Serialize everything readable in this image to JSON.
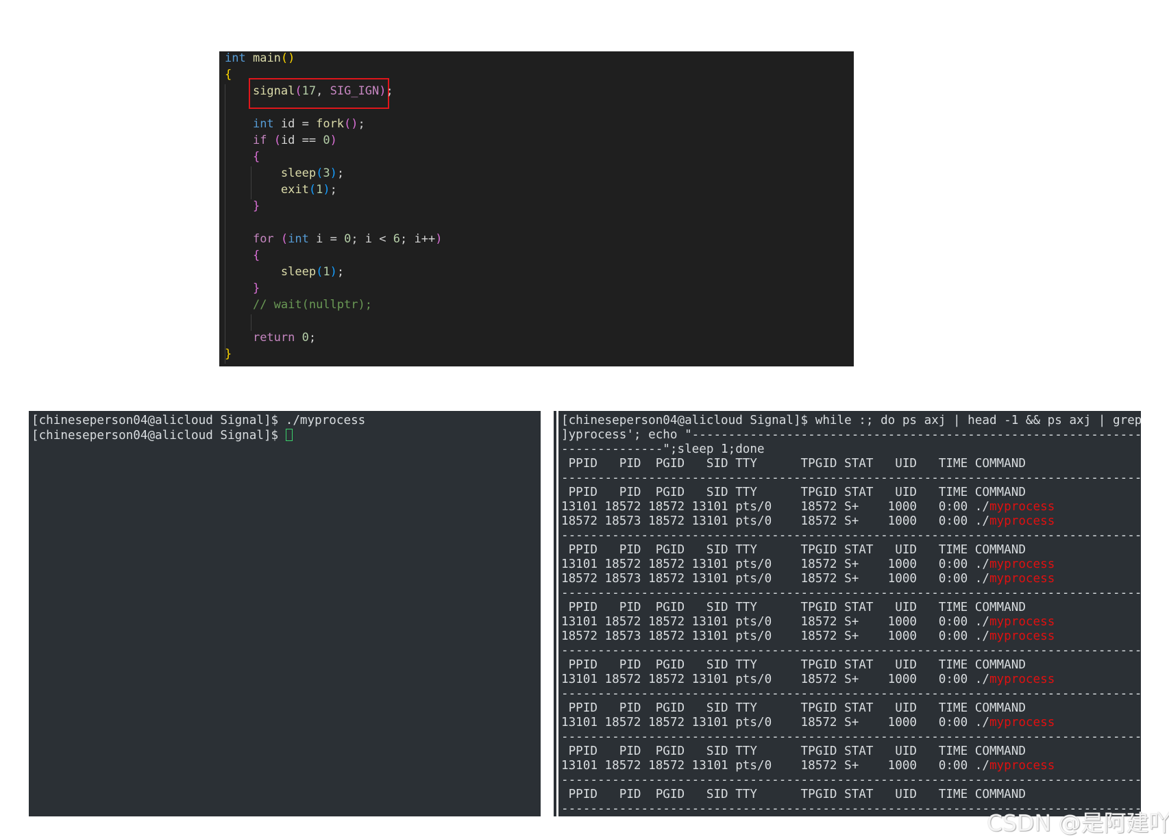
{
  "editor": {
    "lines": [
      [
        [
          "kw",
          "int"
        ],
        [
          "id",
          " "
        ],
        [
          "fn",
          "main"
        ],
        [
          "br1",
          "()"
        ]
      ],
      [
        [
          "br1",
          "{"
        ]
      ],
      [
        [
          "id",
          "    "
        ],
        [
          "fn",
          "signal"
        ],
        [
          "br2",
          "("
        ],
        [
          "num",
          "17"
        ],
        [
          "id",
          ", "
        ],
        [
          "mac",
          "SIG_IGN"
        ],
        [
          "br2",
          ")"
        ],
        [
          "id",
          ";"
        ]
      ],
      [],
      [
        [
          "id",
          "    "
        ],
        [
          "kw",
          "int"
        ],
        [
          "id",
          " id = "
        ],
        [
          "fn",
          "fork"
        ],
        [
          "br2",
          "()"
        ],
        [
          "id",
          ";"
        ]
      ],
      [
        [
          "id",
          "    "
        ],
        [
          "ctl",
          "if"
        ],
        [
          "id",
          " "
        ],
        [
          "br2",
          "("
        ],
        [
          "id",
          "id == "
        ],
        [
          "num",
          "0"
        ],
        [
          "br2",
          ")"
        ]
      ],
      [
        [
          "id",
          "    "
        ],
        [
          "br2",
          "{"
        ]
      ],
      [
        [
          "id",
          "        "
        ],
        [
          "fn",
          "sleep"
        ],
        [
          "br3",
          "("
        ],
        [
          "num",
          "3"
        ],
        [
          "br3",
          ")"
        ],
        [
          "id",
          ";"
        ]
      ],
      [
        [
          "id",
          "        "
        ],
        [
          "fn",
          "exit"
        ],
        [
          "br3",
          "("
        ],
        [
          "num",
          "1"
        ],
        [
          "br3",
          ")"
        ],
        [
          "id",
          ";"
        ]
      ],
      [
        [
          "id",
          "    "
        ],
        [
          "br2",
          "}"
        ]
      ],
      [],
      [
        [
          "id",
          "    "
        ],
        [
          "ctl",
          "for"
        ],
        [
          "id",
          " "
        ],
        [
          "br2",
          "("
        ],
        [
          "kw",
          "int"
        ],
        [
          "id",
          " i = "
        ],
        [
          "num",
          "0"
        ],
        [
          "id",
          "; i < "
        ],
        [
          "num",
          "6"
        ],
        [
          "id",
          "; i++"
        ],
        [
          "br2",
          ")"
        ]
      ],
      [
        [
          "id",
          "    "
        ],
        [
          "br2",
          "{"
        ]
      ],
      [
        [
          "id",
          "        "
        ],
        [
          "fn",
          "sleep"
        ],
        [
          "br3",
          "("
        ],
        [
          "num",
          "1"
        ],
        [
          "br3",
          ")"
        ],
        [
          "id",
          ";"
        ]
      ],
      [
        [
          "id",
          "    "
        ],
        [
          "br2",
          "}"
        ]
      ],
      [
        [
          "id",
          "    "
        ],
        [
          "cmt",
          "// wait(nullptr);"
        ]
      ],
      [],
      [
        [
          "id",
          "    "
        ],
        [
          "ctl",
          "return"
        ],
        [
          "id",
          " "
        ],
        [
          "num",
          "0"
        ],
        [
          "id",
          ";"
        ]
      ],
      [
        [
          "br1",
          "}"
        ]
      ]
    ]
  },
  "terminal_left": {
    "lines": [
      "[chineseperson04@alicloud Signal]$ ./myprocess",
      "[chineseperson04@alicloud Signal]$ "
    ]
  },
  "terminal_right": {
    "lines": [
      {
        "text": "[chineseperson04@alicloud Signal]$ while :; do ps axj | head -1 && ps axj | grep '[m"
      },
      {
        "text": "]yprocess'; echo \"-----------------------------------------------------------------------------"
      },
      {
        "text": "--------------\";sleep 1;done"
      },
      {
        "text": " PPID   PID  PGID   SID TTY      TPGID STAT   UID   TIME COMMAND"
      },
      {
        "text": "---------------------------------------------------------------------------------"
      },
      {
        "text": " PPID   PID  PGID   SID TTY      TPGID STAT   UID   TIME COMMAND"
      },
      {
        "text": "13101 18572 18572 13101 pts/0    18572 S+    1000   0:00 ./",
        "red": "myprocess"
      },
      {
        "text": "18572 18573 18572 13101 pts/0    18572 S+    1000   0:00 ./",
        "red": "myprocess"
      },
      {
        "text": "---------------------------------------------------------------------------------"
      },
      {
        "text": " PPID   PID  PGID   SID TTY      TPGID STAT   UID   TIME COMMAND"
      },
      {
        "text": "13101 18572 18572 13101 pts/0    18572 S+    1000   0:00 ./",
        "red": "myprocess"
      },
      {
        "text": "18572 18573 18572 13101 pts/0    18572 S+    1000   0:00 ./",
        "red": "myprocess"
      },
      {
        "text": "---------------------------------------------------------------------------------"
      },
      {
        "text": " PPID   PID  PGID   SID TTY      TPGID STAT   UID   TIME COMMAND"
      },
      {
        "text": "13101 18572 18572 13101 pts/0    18572 S+    1000   0:00 ./",
        "red": "myprocess"
      },
      {
        "text": "18572 18573 18572 13101 pts/0    18572 S+    1000   0:00 ./",
        "red": "myprocess"
      },
      {
        "text": "---------------------------------------------------------------------------------"
      },
      {
        "text": " PPID   PID  PGID   SID TTY      TPGID STAT   UID   TIME COMMAND"
      },
      {
        "text": "13101 18572 18572 13101 pts/0    18572 S+    1000   0:00 ./",
        "red": "myprocess"
      },
      {
        "text": "---------------------------------------------------------------------------------"
      },
      {
        "text": " PPID   PID  PGID   SID TTY      TPGID STAT   UID   TIME COMMAND"
      },
      {
        "text": "13101 18572 18572 13101 pts/0    18572 S+    1000   0:00 ./",
        "red": "myprocess"
      },
      {
        "text": "---------------------------------------------------------------------------------"
      },
      {
        "text": " PPID   PID  PGID   SID TTY      TPGID STAT   UID   TIME COMMAND"
      },
      {
        "text": "13101 18572 18572 13101 pts/0    18572 S+    1000   0:00 ./",
        "red": "myprocess"
      },
      {
        "text": "---------------------------------------------------------------------------------"
      },
      {
        "text": " PPID   PID  PGID   SID TTY      TPGID STAT   UID   TIME COMMAND"
      },
      {
        "text": "---------------------------------------------------------------------------------"
      }
    ]
  },
  "watermark": "CSDN @是阿建吖!",
  "colors": {
    "editor_bg": "#1f1f1f",
    "terminal_bg": "#2b3035",
    "highlight_box": "#e0161b",
    "process_name": "#e01010",
    "cursor": "#3bd36c"
  }
}
